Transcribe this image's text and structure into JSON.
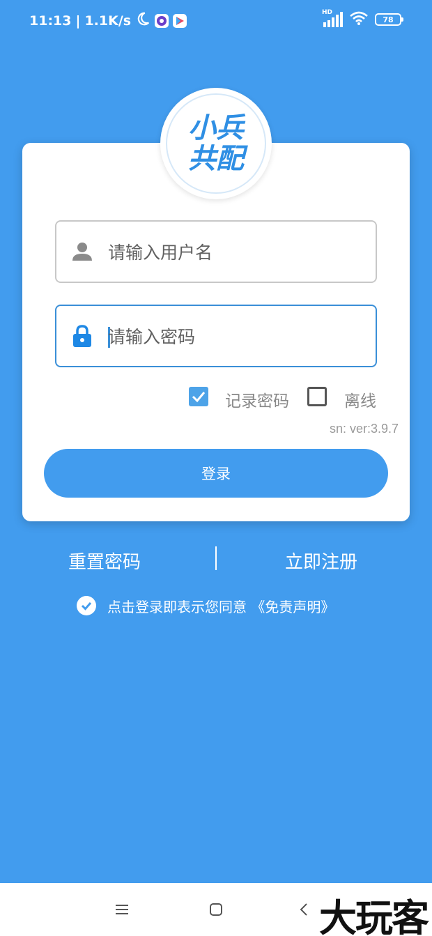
{
  "status_bar": {
    "time": "11:13",
    "separator": "|",
    "speed": "1.1K/s",
    "network_label": "HD",
    "battery": "78"
  },
  "logo": {
    "line1": "小兵",
    "line2": "共配"
  },
  "form": {
    "username_placeholder": "请输入用户名",
    "password_placeholder": "请输入密码",
    "remember_label": "记录密码",
    "offline_label": "离线",
    "version": "sn: ver:3.9.7",
    "login_label": "登录"
  },
  "links": {
    "reset_password": "重置密码",
    "register": "立即注册"
  },
  "agreement": {
    "text": "点击登录即表示您同意",
    "link": "《免责声明》"
  },
  "watermark": "大玩客",
  "colors": {
    "background": "#429cee",
    "accent": "#4da3e8",
    "card": "#ffffff"
  },
  "icons": {
    "username": "person-icon",
    "password": "lock-icon",
    "remember": "checkbox-checked-icon",
    "offline": "checkbox-unchecked-icon",
    "agree": "check-circle-icon",
    "nav_menu": "menu-icon",
    "nav_home": "home-square-icon",
    "nav_back": "back-chevron-icon"
  }
}
